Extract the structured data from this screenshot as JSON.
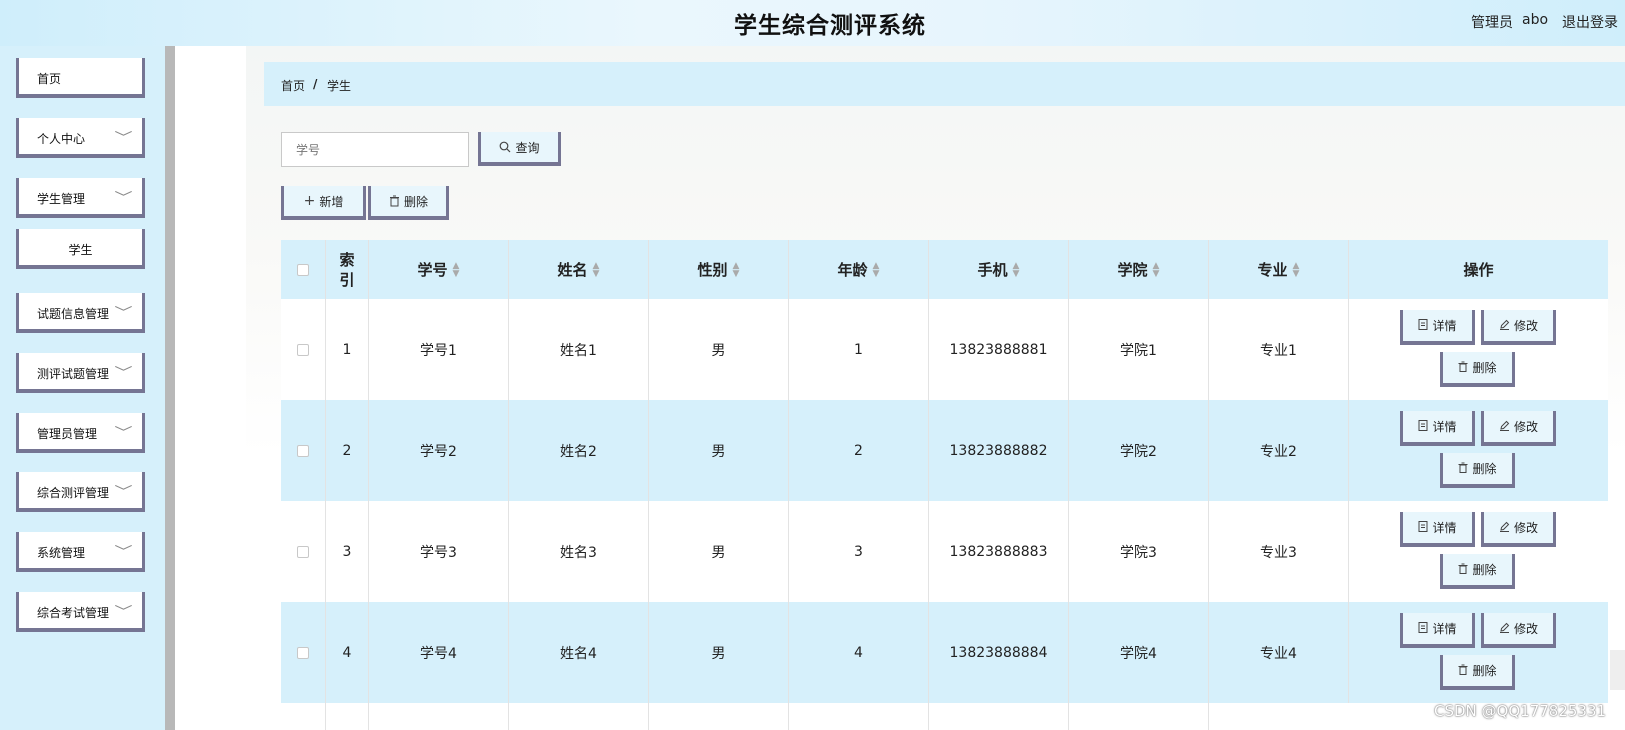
{
  "header": {
    "title": "学生综合测评系统",
    "user_role": "管理员",
    "user_name": "abo",
    "logout": "退出登录"
  },
  "sidebar": {
    "items": [
      {
        "label": "首页",
        "chevron": ""
      },
      {
        "label": "个人中心",
        "chevron": "﹀"
      },
      {
        "label": "学生管理",
        "chevron": "﹀"
      },
      {
        "label": "学生",
        "chevron": ""
      },
      {
        "label": "试题信息管理",
        "chevron": "﹀"
      },
      {
        "label": "测评试题管理",
        "chevron": "﹀"
      },
      {
        "label": "管理员管理",
        "chevron": "﹀"
      },
      {
        "label": "综合测评管理",
        "chevron": "﹀"
      },
      {
        "label": "系统管理",
        "chevron": "﹀"
      },
      {
        "label": "综合考试管理",
        "chevron": "﹀"
      }
    ]
  },
  "breadcrumb": {
    "home": "首页",
    "sep": "/",
    "current": "学生"
  },
  "search": {
    "placeholder": "学号",
    "button": "查询"
  },
  "toolbar": {
    "add": "新增",
    "delete": "删除"
  },
  "table": {
    "headers": [
      "索引",
      "学号",
      "姓名",
      "性别",
      "年龄",
      "手机",
      "学院",
      "专业",
      "操作"
    ],
    "rows": [
      {
        "index": "1",
        "student_no": "学号1",
        "name": "姓名1",
        "gender": "男",
        "age": "1",
        "phone": "13823888881",
        "college": "学院1",
        "major": "专业1"
      },
      {
        "index": "2",
        "student_no": "学号2",
        "name": "姓名2",
        "gender": "男",
        "age": "2",
        "phone": "13823888882",
        "college": "学院2",
        "major": "专业2"
      },
      {
        "index": "3",
        "student_no": "学号3",
        "name": "姓名3",
        "gender": "男",
        "age": "3",
        "phone": "13823888883",
        "college": "学院3",
        "major": "专业3"
      },
      {
        "index": "4",
        "student_no": "学号4",
        "name": "姓名4",
        "gender": "男",
        "age": "4",
        "phone": "13823888884",
        "college": "学院4",
        "major": "专业4"
      }
    ],
    "actions": {
      "detail": "详情",
      "edit": "修改",
      "delete": "删除"
    }
  },
  "watermark": "CSDN @QQ177825331"
}
